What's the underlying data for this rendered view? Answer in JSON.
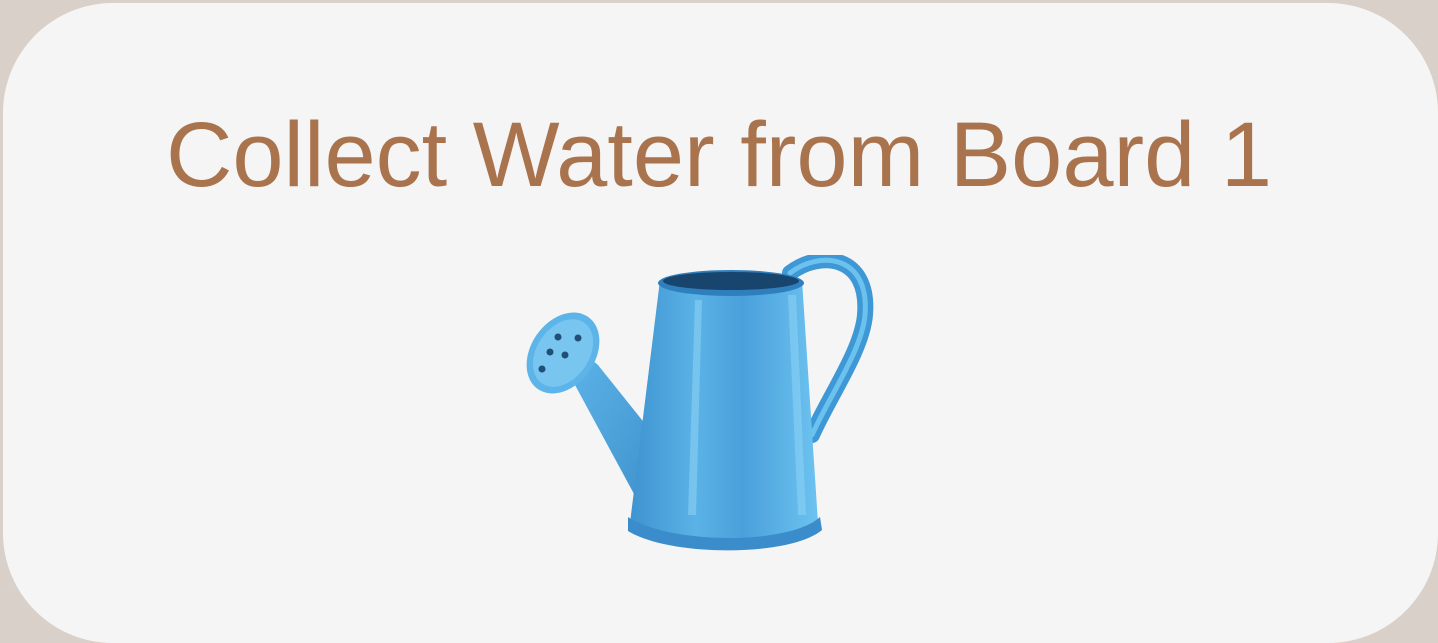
{
  "card": {
    "title": "Collect Water from Board 1",
    "image_icon": "watering-can-icon"
  },
  "colors": {
    "page_background": "#d9d0ca",
    "card_background": "#f5f5f5",
    "title_color": "#a9744d",
    "can_blue": "#4aa3dc"
  }
}
